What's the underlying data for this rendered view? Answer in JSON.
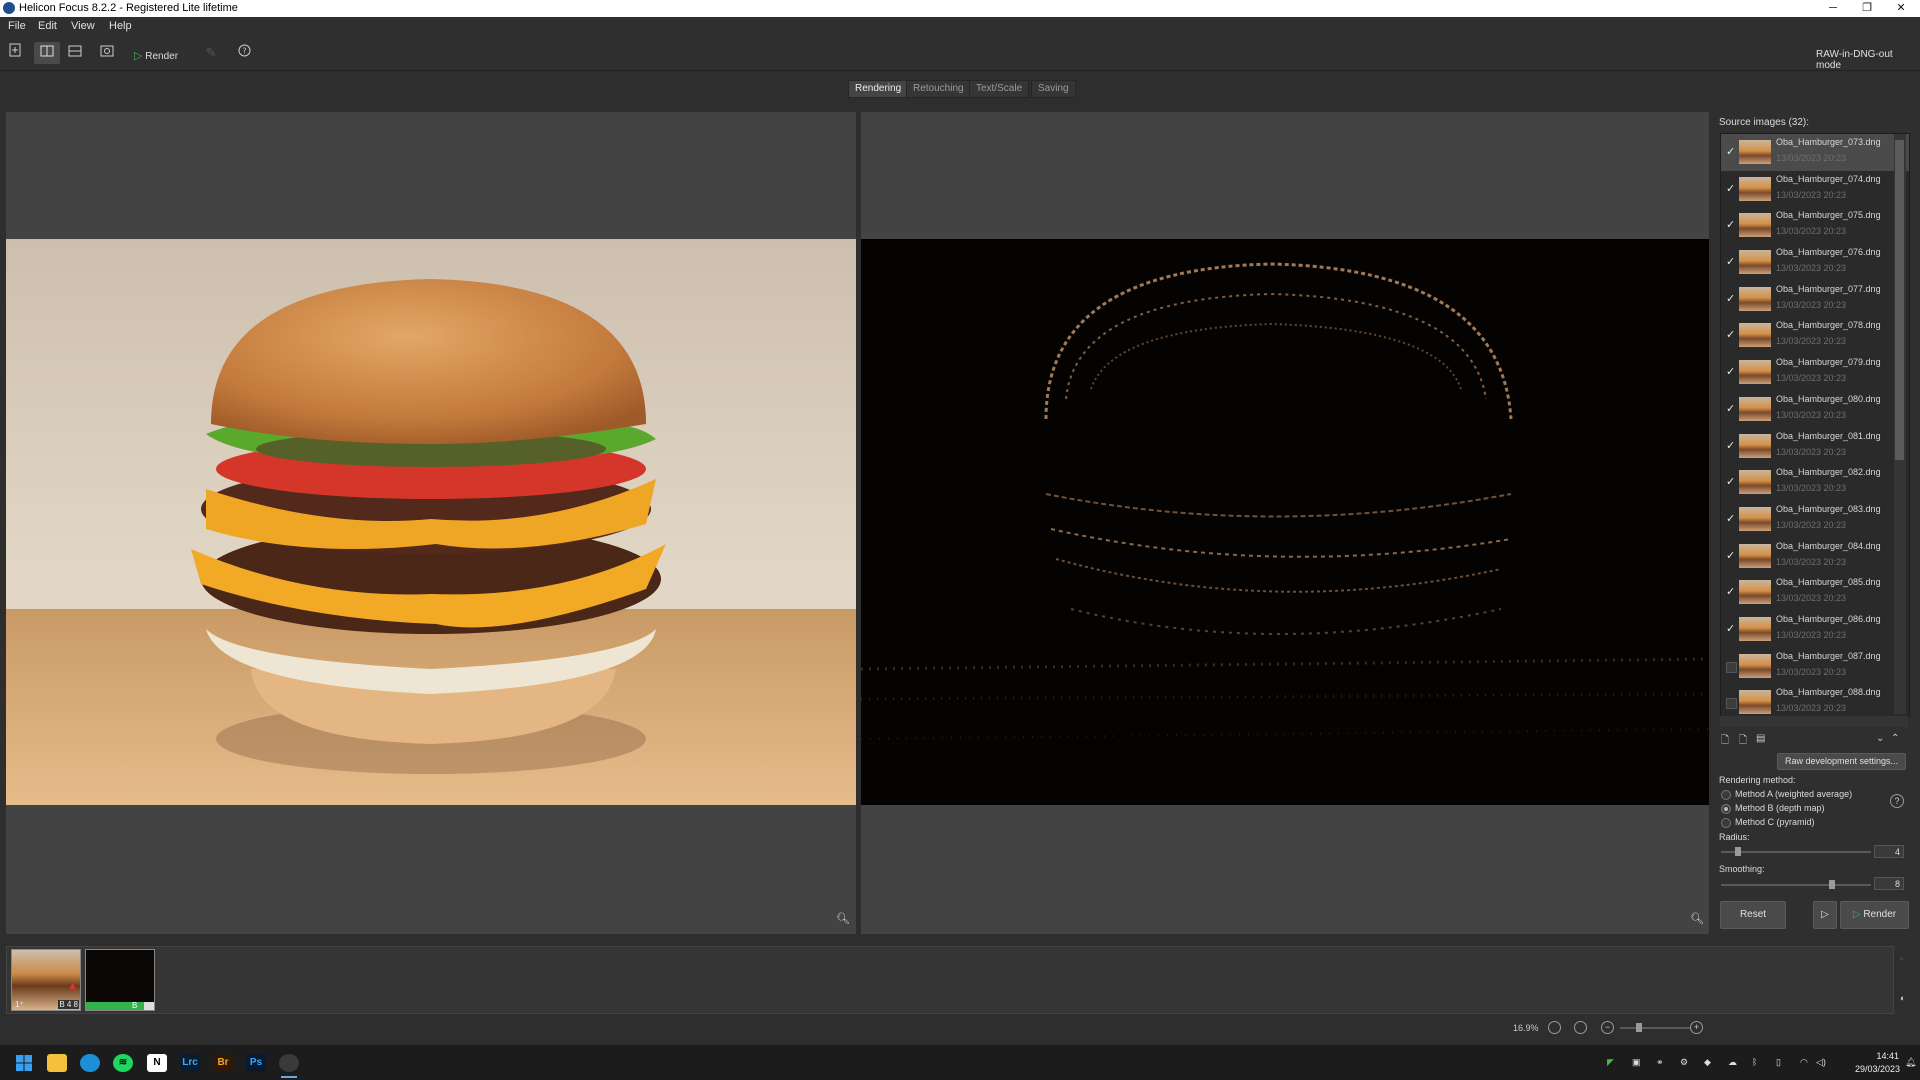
{
  "window": {
    "title": "Helicon Focus 8.2.2 - Registered Lite lifetime"
  },
  "menu": [
    "File",
    "Edit",
    "View",
    "Help"
  ],
  "toolbar": {
    "render_label": "Render",
    "mode_label": "RAW-in-DNG-out mode"
  },
  "tabs": [
    "Rendering",
    "Retouching",
    "Text/Scale",
    "Saving"
  ],
  "source": {
    "header": "Source images (32):",
    "items": [
      {
        "name": "Oba_Hamburger_073.dng",
        "date": "13/03/2023 20:23",
        "checked": true
      },
      {
        "name": "Oba_Hamburger_074.dng",
        "date": "13/03/2023 20:23",
        "checked": true
      },
      {
        "name": "Oba_Hamburger_075.dng",
        "date": "13/03/2023 20:23",
        "checked": true
      },
      {
        "name": "Oba_Hamburger_076.dng",
        "date": "13/03/2023 20:23",
        "checked": true
      },
      {
        "name": "Oba_Hamburger_077.dng",
        "date": "13/03/2023 20:23",
        "checked": true
      },
      {
        "name": "Oba_Hamburger_078.dng",
        "date": "13/03/2023 20:23",
        "checked": true
      },
      {
        "name": "Oba_Hamburger_079.dng",
        "date": "13/03/2023 20:23",
        "checked": true
      },
      {
        "name": "Oba_Hamburger_080.dng",
        "date": "13/03/2023 20:23",
        "checked": true
      },
      {
        "name": "Oba_Hamburger_081.dng",
        "date": "13/03/2023 20:23",
        "checked": true
      },
      {
        "name": "Oba_Hamburger_082.dng",
        "date": "13/03/2023 20:23",
        "checked": true
      },
      {
        "name": "Oba_Hamburger_083.dng",
        "date": "13/03/2023 20:23",
        "checked": true
      },
      {
        "name": "Oba_Hamburger_084.dng",
        "date": "13/03/2023 20:23",
        "checked": true
      },
      {
        "name": "Oba_Hamburger_085.dng",
        "date": "13/03/2023 20:23",
        "checked": true
      },
      {
        "name": "Oba_Hamburger_086.dng",
        "date": "13/03/2023 20:23",
        "checked": true
      },
      {
        "name": "Oba_Hamburger_087.dng",
        "date": "13/03/2023 20:23",
        "checked": false
      },
      {
        "name": "Oba_Hamburger_088.dng",
        "date": "13/03/2023 20:23",
        "checked": false
      }
    ],
    "raw_button": "Raw development settings..."
  },
  "rendering": {
    "header": "Rendering method:",
    "methods": [
      "Method A (weighted average)",
      "Method B (depth map)",
      "Method C (pyramid)"
    ],
    "selected": 1,
    "radius_label": "Radius:",
    "radius_value": "4",
    "radius_level": 0.1,
    "smoothing_label": "Smoothing:",
    "smoothing_value": "8",
    "smoothing_level": 0.75,
    "reset_label": "Reset",
    "render_label": "Render"
  },
  "filmstrip": {
    "thumb1_caption": "B 4 8",
    "thumb1_prefix": "1⁺",
    "thumb2_caption": "B",
    "progress": 0.85
  },
  "statusbar": {
    "zoom": "16.9%"
  },
  "taskbar": {
    "apps": [
      "windows-start-icon",
      "file-explorer-icon",
      "edge-icon",
      "spotify-icon",
      "notion-icon",
      "lightroom-icon",
      "bridge-icon",
      "photoshop-icon",
      "helicon-icon"
    ],
    "time": "14:41",
    "date": "29/03/2023"
  }
}
